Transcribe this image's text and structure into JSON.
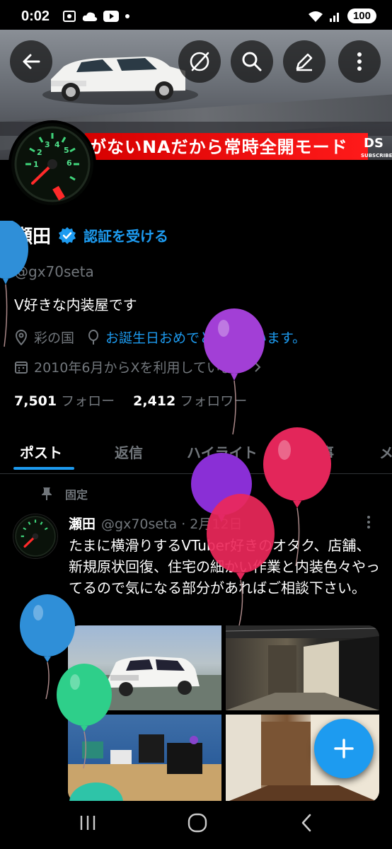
{
  "status_bar": {
    "time": "0:02",
    "battery": "100"
  },
  "header": {
    "banner_text": "がないNAだから常時全開モード",
    "banner_badge_text": "DS",
    "banner_badge_label": "SUBSCRIBE"
  },
  "profile": {
    "name": "瀬田",
    "verify_link": "認証を受ける",
    "handle": "@gx70seta",
    "bio": "V好きな内装屋です",
    "location": "彩の国",
    "birthday": "お誕生日おめでとうございます。",
    "joined": "2010年6月からXを利用しています",
    "following_count": "7,501",
    "following_label": "フォロー",
    "followers_count": "2,412",
    "followers_label": "フォロワー"
  },
  "tabs": [
    "ポスト",
    "返信",
    "ハイライト",
    "記事",
    "メ"
  ],
  "pinned_post": {
    "pinned_label": "固定",
    "author": "瀬田",
    "handle_date": "@gx70seta · 2月12日",
    "text": "たまに横滑りするVTuber好きのオタク、店舗、新規原状回復、住宅の細かい作業と内装色々やってるので気になる部分があればご相談下さい。"
  },
  "colors": {
    "accent": "#1d9bf0",
    "background": "#000000",
    "muted": "#71767b"
  },
  "icons": [
    "back-arrow-icon",
    "unmute-icon",
    "search-icon",
    "edit-icon",
    "more-vertical-icon",
    "verified-badge-icon",
    "location-icon",
    "balloon-icon",
    "calendar-icon",
    "chevron-right-icon",
    "pin-icon",
    "compose-plus-icon",
    "recents-icon",
    "home-icon",
    "back-icon"
  ]
}
